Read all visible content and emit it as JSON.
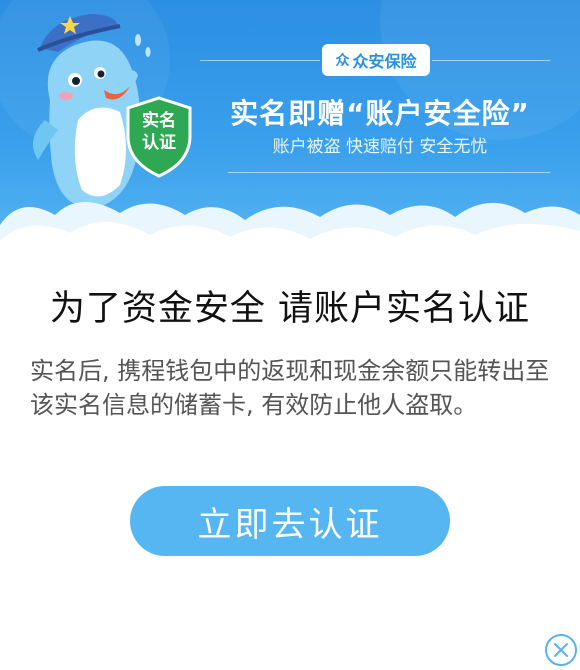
{
  "banner": {
    "brand_logo": "众",
    "brand_name": "众安保险",
    "promo_title": "实名即赠“账户安全险”",
    "promo_subtitle": "账户被盗 快速赔付 安全无忧",
    "badge_line1": "实名",
    "badge_line2": "认证"
  },
  "main": {
    "heading": "为了资金安全 请账户实名认证",
    "description": "实名后, 携程钱包中的返现和现金余额只能转出至该实名信息的储蓄卡, 有效防止他人盗取。",
    "cta_label": "立即去认证"
  },
  "icons": {
    "close": "close-icon",
    "mascot": "dolphin-mascot-icon",
    "badge": "shield-badge-icon"
  },
  "colors": {
    "banner_blue": "#3aa0ec",
    "cta_blue": "#56b6f2",
    "badge_green": "#2ea853"
  }
}
